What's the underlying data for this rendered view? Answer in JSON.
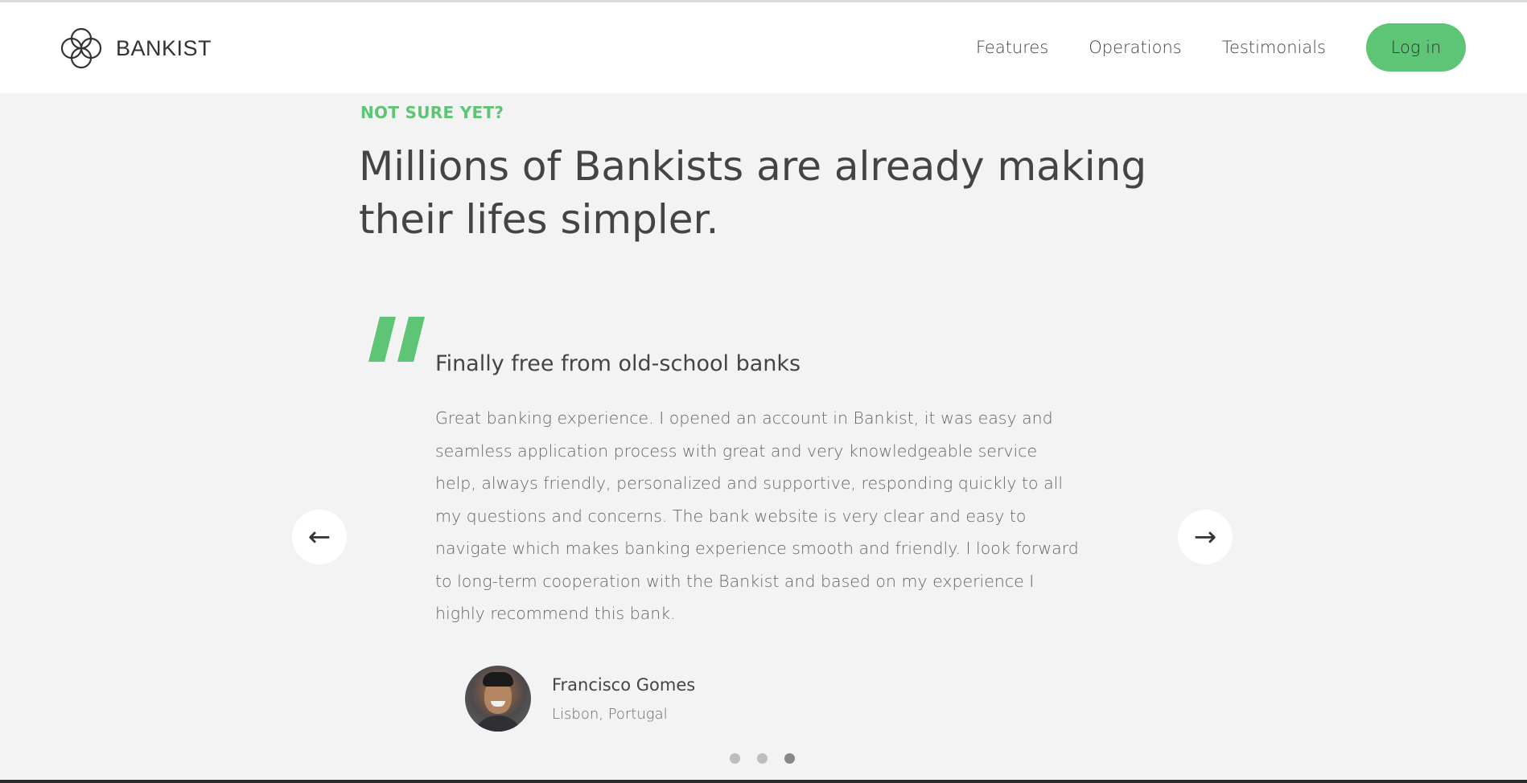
{
  "brand": {
    "name": "BANKIST",
    "accent_color": "#5ec576",
    "logo_icon": "four-circle-logo-icon"
  },
  "nav": {
    "links": [
      "Features",
      "Operations",
      "Testimonials"
    ],
    "login_label": "Log in"
  },
  "section": {
    "label": "NOT SURE YET?",
    "title": "Millions of Bankists are already making their lifes simpler."
  },
  "testimonial": {
    "quote_icon": "quote-mark-icon",
    "heading": "Finally free from old-school banks",
    "text": "Great banking experience. I opened an account in Bankist, it was easy and seamless application process with great and very knowledgeable service help, always friendly, personalized and supportive, responding quickly to all my questions and concerns. The bank website is very clear and easy to navigate which makes banking experience smooth and friendly. I look forward to long-term cooperation with the Bankist and based on my experience I highly recommend this bank.",
    "author_name": "Francisco Gomes",
    "author_location": "Lisbon, Portugal"
  },
  "slider": {
    "prev_arrow": "←",
    "next_arrow": "→",
    "dots_total": 3,
    "active_dot": 3
  }
}
